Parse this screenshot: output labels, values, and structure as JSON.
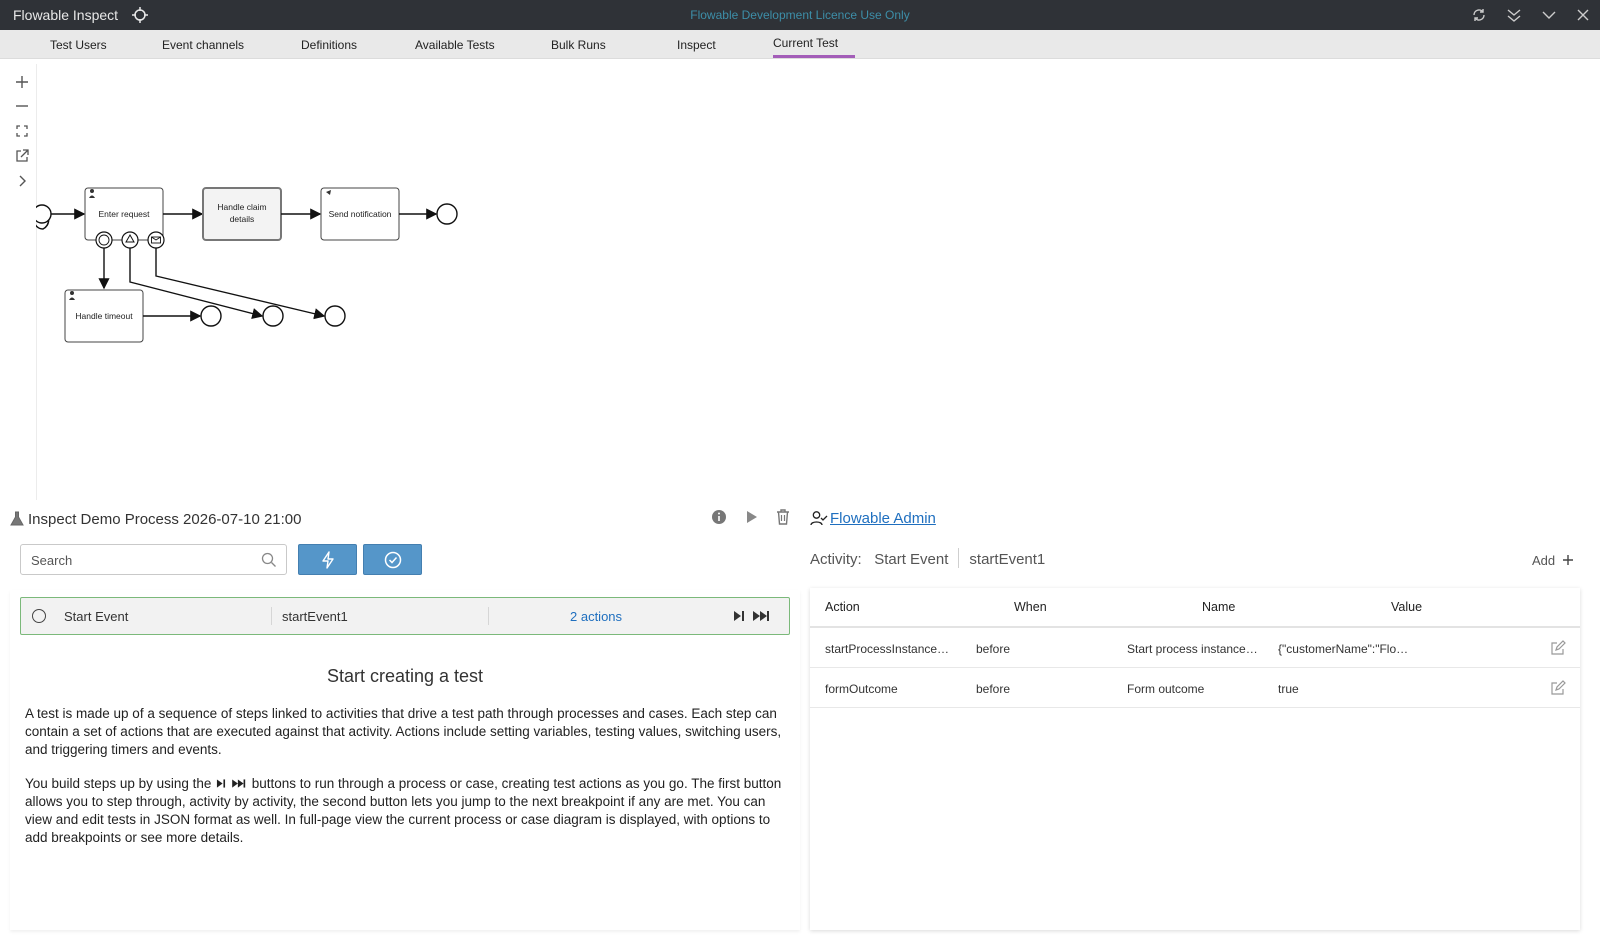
{
  "app": {
    "title": "Flowable Inspect",
    "licence_notice": "Flowable Development Licence Use Only"
  },
  "tabs": [
    {
      "label": "Test Users"
    },
    {
      "label": "Event channels"
    },
    {
      "label": "Definitions"
    },
    {
      "label": "Available Tests"
    },
    {
      "label": "Bulk Runs"
    },
    {
      "label": "Inspect"
    },
    {
      "label": "Current Test",
      "active": true
    }
  ],
  "diagram": {
    "tasks": {
      "enter_request": "Enter request",
      "handle_claim_line1": "Handle claim",
      "handle_claim_line2": "details",
      "send_notification": "Send notification",
      "handle_timeout": "Handle timeout"
    }
  },
  "test": {
    "title": "Inspect Demo Process 2026-07-10 21:00",
    "user": "Flowable Admin",
    "search_placeholder": "Search"
  },
  "step": {
    "name": "Start Event",
    "id": "startEvent1",
    "actions": "2 actions"
  },
  "intro": {
    "heading": "Start creating a test",
    "p1": "A test is made up of a sequence of steps linked to activities that drive a test path through processes and cases. Each step can contain a set of actions that are executed against that activity. Actions include setting variables, testing values, switching users, and triggering timers and events.",
    "p2_before": "You build steps up by using the",
    "p2_after": "buttons to run through a process or case, creating test actions as you go. The first button allows you to step through, activity by activity, the second button lets you jump to the next breakpoint if any are met. You can view and edit tests in JSON format as well. In full-page view the current process or case diagram is displayed, with options to add breakpoints or see more details."
  },
  "activity": {
    "label": "Activity:",
    "name": "Start Event",
    "id": "startEvent1",
    "add_label": "Add"
  },
  "actions_table": {
    "headers": [
      "Action",
      "When",
      "Name",
      "Value"
    ],
    "rows": [
      {
        "action": "startProcessInstance…",
        "when": "before",
        "name": "Start process instance…",
        "value": "{\"customerName\":\"Flo…"
      },
      {
        "action": "formOutcome",
        "when": "before",
        "name": "Form outcome",
        "value": "true"
      }
    ]
  },
  "colors": {
    "titlebar": "#2f3237",
    "accent_tab": "#a35db8",
    "primary_button": "#5596c9",
    "link": "#1f6fbf",
    "step_border": "#7bb97a"
  },
  "icons": [
    "target-icon",
    "refresh-icon",
    "double-chevron-down-icon",
    "chevron-down-icon",
    "close-icon",
    "zoom-in-icon",
    "zoom-out-icon",
    "fit-icon",
    "open-external-icon",
    "chevron-right-icon",
    "flask-icon",
    "info-icon",
    "play-icon",
    "trash-icon",
    "user-check-icon",
    "search-icon",
    "lightning-icon",
    "check-circle-icon",
    "step-icon",
    "skip-icon",
    "edit-icon",
    "plus-icon"
  ]
}
